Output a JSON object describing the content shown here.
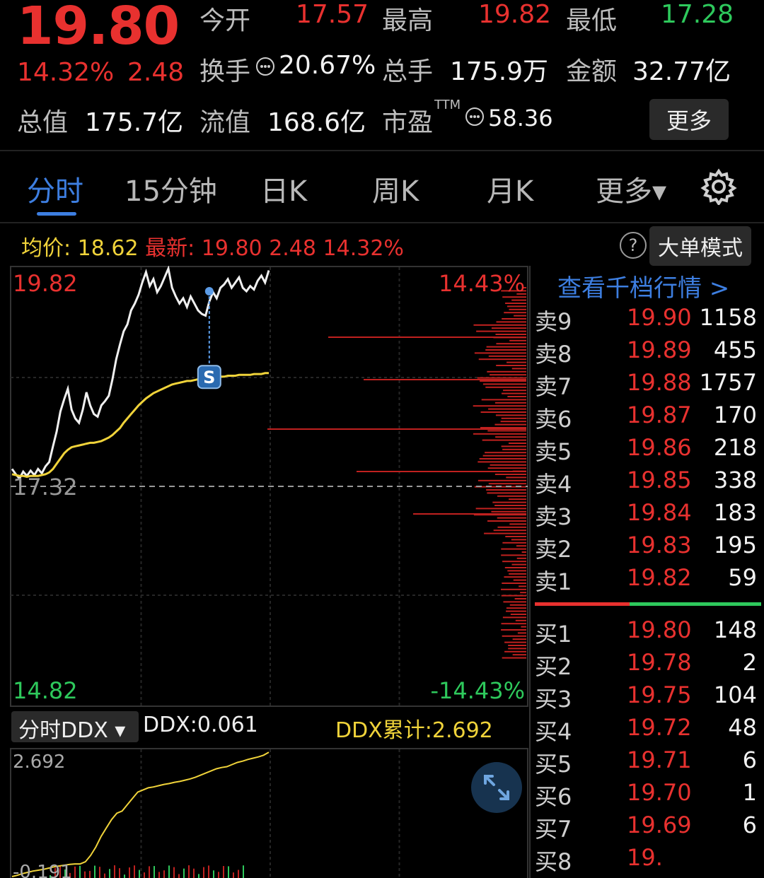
{
  "quote": {
    "price": "19.80",
    "change_pct": "14.32%",
    "change_amt": "2.48",
    "open_label": "今开",
    "open": "17.57",
    "high_label": "最高",
    "high": "19.82",
    "low_label": "最低",
    "low": "17.28",
    "turnover_label": "换手",
    "turnover": "20.67%",
    "volume_label": "总手",
    "volume": "175.9万",
    "amount_label": "金额",
    "amount": "32.77亿",
    "total_value_label": "总值",
    "total_value": "175.7亿",
    "float_value_label": "流值",
    "float_value": "168.6亿",
    "pe_label": "市盈",
    "pe_sup": "TTM",
    "pe": "58.36",
    "more_label": "更多"
  },
  "tabs": [
    {
      "label": "分时",
      "active": true
    },
    {
      "label": "15分钟"
    },
    {
      "label": "日K"
    },
    {
      "label": "周K"
    },
    {
      "label": "月K"
    },
    {
      "label": "更多▾"
    }
  ],
  "info_bar": {
    "avg_label": "均价:",
    "avg": "18.62",
    "latest_label": "最新:",
    "latest": "19.80",
    "latest_chg": "2.48",
    "latest_pct": "14.32%",
    "help": "?",
    "mode_button": "大单模式"
  },
  "chart_data": [
    {
      "type": "line",
      "y_max_label": "19.82",
      "y_min_label": "14.82",
      "ref_label": "17.32",
      "pct_max_label": "14.43%",
      "pct_min_label": "-14.43%",
      "ylim": [
        14.82,
        19.82
      ],
      "reference": 17.32,
      "marker": "S",
      "series": [
        {
          "color": "#f0f0f0",
          "values": [
            17.52,
            17.46,
            17.41,
            17.49,
            17.44,
            17.5,
            17.45,
            17.52,
            17.47,
            17.55,
            17.6,
            17.78,
            17.95,
            18.18,
            18.32,
            18.44,
            18.2,
            18.1,
            18.05,
            18.2,
            18.4,
            18.25,
            18.15,
            18.12,
            18.25,
            18.3,
            18.36,
            18.55,
            18.78,
            18.95,
            19.1,
            19.18,
            19.34,
            19.42,
            19.52,
            19.66,
            19.78,
            19.62,
            19.7,
            19.55,
            19.62,
            19.72,
            19.82,
            19.6,
            19.5,
            19.42,
            19.48,
            19.38,
            19.5,
            19.42,
            19.34,
            19.3,
            19.28,
            19.44,
            19.55,
            19.48,
            19.6,
            19.64,
            19.7,
            19.6,
            19.66,
            19.72,
            19.6,
            19.56,
            19.62,
            19.58,
            19.68,
            19.74,
            19.66,
            19.8
          ]
        },
        {
          "color": "#f0d33a",
          "values": [
            17.46,
            17.45,
            17.44,
            17.44,
            17.43,
            17.44,
            17.44,
            17.44,
            17.45,
            17.46,
            17.48,
            17.52,
            17.58,
            17.64,
            17.7,
            17.74,
            17.77,
            17.78,
            17.79,
            17.8,
            17.81,
            17.82,
            17.82,
            17.83,
            17.84,
            17.86,
            17.88,
            17.91,
            17.95,
            17.99,
            18.05,
            18.1,
            18.15,
            18.2,
            18.25,
            18.29,
            18.33,
            18.36,
            18.39,
            18.41,
            18.43,
            18.45,
            18.47,
            18.49,
            18.5,
            18.51,
            18.52,
            18.53,
            18.53,
            18.54,
            18.55,
            18.55,
            18.56,
            18.56,
            18.57,
            18.57,
            18.58,
            18.58,
            18.59,
            18.59,
            18.59,
            18.6,
            18.6,
            18.6,
            18.6,
            18.61,
            18.61,
            18.61,
            18.62,
            18.62
          ]
        }
      ]
    },
    {
      "type": "line",
      "selector": "分时DDX ▾",
      "ddx_label": "DDX:0.061",
      "ddx_cum_label": "DDX累计:2.692",
      "y_max_label": "2.692",
      "y_min_label": "-0.191",
      "ylim": [
        -0.25,
        2.692
      ],
      "series": [
        {
          "color": "#f0d33a",
          "values": [
            -0.25,
            -0.22,
            -0.18,
            -0.15,
            -0.12,
            -0.1,
            -0.08,
            -0.05,
            -0.02,
            0.0,
            0.02,
            0.04,
            0.05,
            0.05,
            0.1,
            0.25,
            0.45,
            0.7,
            0.9,
            1.1,
            1.25,
            1.3,
            1.45,
            1.6,
            1.75,
            1.8,
            1.85,
            1.87,
            1.9,
            1.93,
            1.95,
            1.98,
            2.0,
            2.03,
            2.06,
            2.1,
            2.15,
            2.2,
            2.25,
            2.3,
            2.33,
            2.35,
            2.4,
            2.45,
            2.48,
            2.52,
            2.55,
            2.58,
            2.62,
            2.69
          ]
        }
      ]
    }
  ],
  "order_book": {
    "header": "查看千档行情 >",
    "asks": [
      {
        "label": "卖9",
        "price": "19.90",
        "vol": "1158"
      },
      {
        "label": "卖8",
        "price": "19.89",
        "vol": "455"
      },
      {
        "label": "卖7",
        "price": "19.88",
        "vol": "1757"
      },
      {
        "label": "卖6",
        "price": "19.87",
        "vol": "170"
      },
      {
        "label": "卖5",
        "price": "19.86",
        "vol": "218"
      },
      {
        "label": "卖4",
        "price": "19.85",
        "vol": "338"
      },
      {
        "label": "卖3",
        "price": "19.84",
        "vol": "183"
      },
      {
        "label": "卖2",
        "price": "19.83",
        "vol": "195"
      },
      {
        "label": "卖1",
        "price": "19.82",
        "vol": "59"
      }
    ],
    "bids": [
      {
        "label": "买1",
        "price": "19.80",
        "vol": "148"
      },
      {
        "label": "买2",
        "price": "19.78",
        "vol": "2"
      },
      {
        "label": "买3",
        "price": "19.75",
        "vol": "104"
      },
      {
        "label": "买4",
        "price": "19.72",
        "vol": "48"
      },
      {
        "label": "买5",
        "price": "19.71",
        "vol": "6"
      },
      {
        "label": "买6",
        "price": "19.70",
        "vol": "1"
      },
      {
        "label": "买7",
        "price": "19.69",
        "vol": "6"
      },
      {
        "label": "买8",
        "price": "19.",
        "vol": ""
      }
    ]
  },
  "colors": {
    "up": "#e8312f",
    "down": "#2ec95c",
    "accent": "#3d7ee0",
    "avg_line": "#f0d33a"
  }
}
